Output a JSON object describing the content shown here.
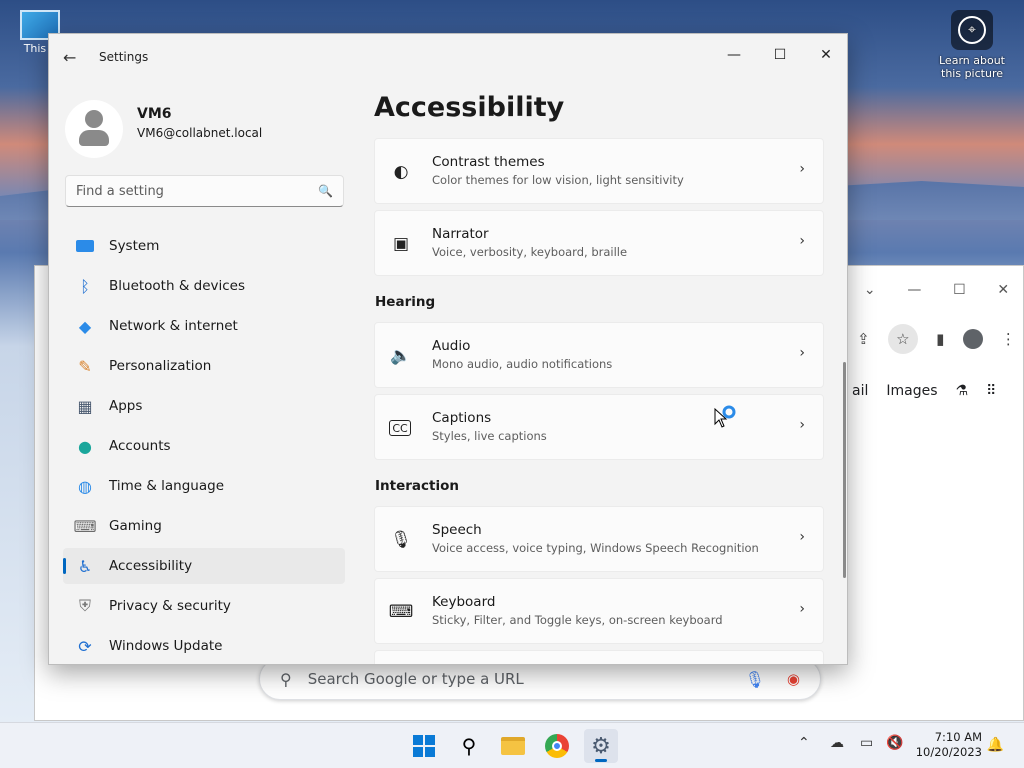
{
  "desktop": {
    "icon_label": "This P",
    "learn_label": "Learn about this picture"
  },
  "chrome": {
    "links": [
      "ail",
      "Images"
    ],
    "search_placeholder": "Search Google or type a URL"
  },
  "settings": {
    "app_title": "Settings",
    "user": {
      "name": "VM6",
      "email": "VM6@collabnet.local"
    },
    "search_placeholder": "Find a setting",
    "nav": [
      {
        "label": "System",
        "icon": "monitor-icon"
      },
      {
        "label": "Bluetooth & devices",
        "icon": "bluetooth-icon"
      },
      {
        "label": "Network & internet",
        "icon": "wifi-icon"
      },
      {
        "label": "Personalization",
        "icon": "brush-icon"
      },
      {
        "label": "Apps",
        "icon": "apps-icon"
      },
      {
        "label": "Accounts",
        "icon": "person-icon"
      },
      {
        "label": "Time & language",
        "icon": "globe-clock-icon"
      },
      {
        "label": "Gaming",
        "icon": "gamepad-icon"
      },
      {
        "label": "Accessibility",
        "icon": "accessibility-icon",
        "active": true
      },
      {
        "label": "Privacy & security",
        "icon": "shield-icon"
      },
      {
        "label": "Windows Update",
        "icon": "update-icon"
      }
    ],
    "page_title": "Accessibility",
    "cards": [
      {
        "title": "Contrast themes",
        "desc": "Color themes for low vision, light sensitivity",
        "icon": "contrast-icon"
      },
      {
        "title": "Narrator",
        "desc": "Voice, verbosity, keyboard, braille",
        "icon": "narrator-icon"
      },
      {
        "title": "Audio",
        "desc": "Mono audio, audio notifications",
        "icon": "speaker-icon"
      },
      {
        "title": "Captions",
        "desc": "Styles, live captions",
        "icon": "captions-icon"
      },
      {
        "title": "Speech",
        "desc": "Voice access, voice typing, Windows Speech Recognition",
        "icon": "microphone-icon"
      },
      {
        "title": "Keyboard",
        "desc": "Sticky, Filter, and Toggle keys, on-screen keyboard",
        "icon": "keyboard-icon"
      }
    ],
    "sections": {
      "hearing": "Hearing",
      "interaction": "Interaction"
    }
  },
  "taskbar": {
    "apps": [
      "start-icon",
      "search-icon",
      "file-explorer-icon",
      "chrome-icon",
      "settings-icon"
    ],
    "time": "7:10 AM",
    "date": "10/20/2023"
  },
  "colors": {
    "accent": "#0067c0",
    "window_bg": "#f3f3f3",
    "card_bg": "#fbfbfb"
  }
}
